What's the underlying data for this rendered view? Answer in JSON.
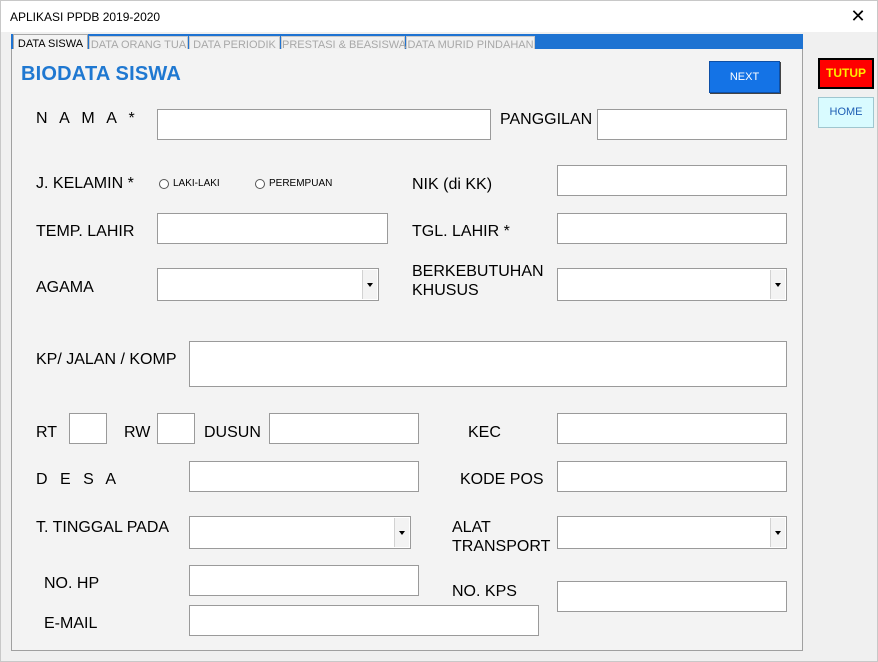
{
  "window": {
    "title": "APLIKASI PPDB 2019-2020",
    "close_glyph": "✕"
  },
  "tabs": [
    {
      "label": "DATA SISWA"
    },
    {
      "label": "DATA ORANG TUA"
    },
    {
      "label": "DATA PERIODIK"
    },
    {
      "label": "PRESTASI & BEASISWA"
    },
    {
      "label": "DATA MURID PINDAHAN"
    }
  ],
  "form": {
    "heading": "BIODATA SISWA",
    "next_label": "NEXT",
    "labels": {
      "nama": "N A M A *",
      "panggilan": "PANGGILAN",
      "kelamin": "J. KELAMIN *",
      "nik": "NIK (di KK)",
      "tempat_lahir": "TEMP. LAHIR",
      "tgl_lahir": "TGL. LAHIR *",
      "agama": "AGAMA",
      "berkebutuhan_1": "BERKEBUTUHAN",
      "berkebutuhan_2": "KHUSUS",
      "jalan": "KP/ JALAN / KOMP",
      "rt": "RT",
      "rw": "RW",
      "dusun": "DUSUN",
      "kec": "KEC",
      "desa": "D E S A",
      "kode_pos": "KODE POS",
      "tinggal": "T. TINGGAL PADA",
      "transport_1": "ALAT",
      "transport_2": "TRANSPORT",
      "hp": "NO. HP",
      "kps": "NO. KPS",
      "email": "E-MAIL"
    },
    "radio_options": {
      "male": "LAKI-LAKI",
      "female": "PEREMPUAN"
    },
    "values": {
      "nama": "",
      "panggilan": "",
      "nik": "",
      "tempat_lahir": "",
      "tgl_lahir": "",
      "jalan": "",
      "rt": "",
      "rw": "",
      "dusun": "",
      "kec": "",
      "desa": "",
      "kode_pos": "",
      "hp": "",
      "kps": "",
      "email": ""
    }
  },
  "side_buttons": {
    "tutup": "TUTUP",
    "home": "HOME"
  },
  "colors": {
    "accent_blue": "#1e73d2",
    "tutup_bg": "#ff0000",
    "tutup_text": "#ffeb00",
    "home_bg": "#d9fbff"
  }
}
